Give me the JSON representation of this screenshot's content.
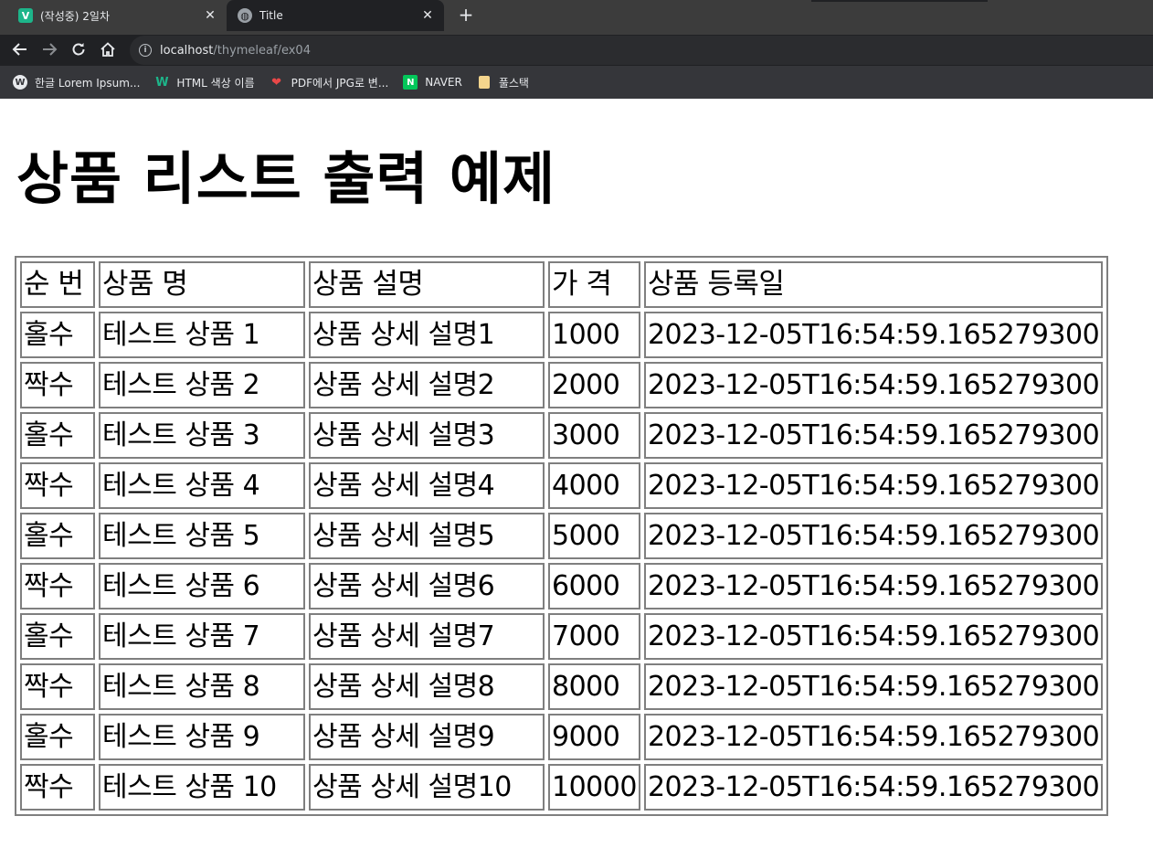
{
  "browser": {
    "tabs": [
      {
        "title": "(작성중) 2일차",
        "icon": "v-logo-icon",
        "active": false
      },
      {
        "title": "Title",
        "icon": "globe-icon",
        "active": true
      }
    ],
    "new_tab_glyph": "+",
    "close_glyph": "✕",
    "url": {
      "host": "localhost",
      "path": "/thymeleaf/ex04"
    },
    "bookmarks": [
      {
        "label": "한글 Lorem Ipsum...",
        "icon": "wordpress-icon"
      },
      {
        "label": "HTML 색상 이름",
        "icon": "w-logo-icon"
      },
      {
        "label": "PDF에서 JPG로 변...",
        "icon": "heart-icon"
      },
      {
        "label": "NAVER",
        "icon": "naver-icon"
      },
      {
        "label": "풀스택",
        "icon": "folder-icon"
      }
    ]
  },
  "page": {
    "title": "상품 리스트 출력 예제",
    "table": {
      "headers": [
        "순 번",
        "상품 명",
        "상품 설명",
        "가 격",
        "상품 등록일"
      ],
      "rows": [
        [
          "홀수",
          "테스트 상품 1",
          "상품 상세 설명1",
          "1000",
          "2023-12-05T16:54:59.165279300"
        ],
        [
          "짝수",
          "테스트 상품 2",
          "상품 상세 설명2",
          "2000",
          "2023-12-05T16:54:59.165279300"
        ],
        [
          "홀수",
          "테스트 상품 3",
          "상품 상세 설명3",
          "3000",
          "2023-12-05T16:54:59.165279300"
        ],
        [
          "짝수",
          "테스트 상품 4",
          "상품 상세 설명4",
          "4000",
          "2023-12-05T16:54:59.165279300"
        ],
        [
          "홀수",
          "테스트 상품 5",
          "상품 상세 설명5",
          "5000",
          "2023-12-05T16:54:59.165279300"
        ],
        [
          "짝수",
          "테스트 상품 6",
          "상품 상세 설명6",
          "6000",
          "2023-12-05T16:54:59.165279300"
        ],
        [
          "홀수",
          "테스트 상품 7",
          "상품 상세 설명7",
          "7000",
          "2023-12-05T16:54:59.165279300"
        ],
        [
          "짝수",
          "테스트 상품 8",
          "상품 상세 설명8",
          "8000",
          "2023-12-05T16:54:59.165279300"
        ],
        [
          "홀수",
          "테스트 상품 9",
          "상품 상세 설명9",
          "9000",
          "2023-12-05T16:54:59.165279300"
        ],
        [
          "짝수",
          "테스트 상품 10",
          "상품 상세 설명10",
          "10000",
          "2023-12-05T16:54:59.165279300"
        ]
      ]
    }
  }
}
